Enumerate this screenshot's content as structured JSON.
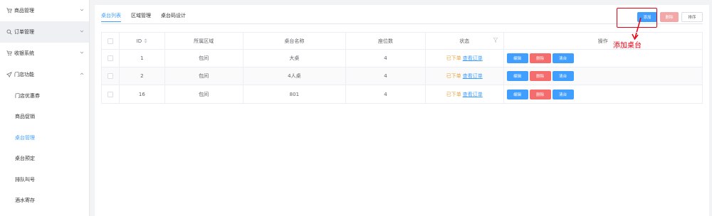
{
  "sidebar": {
    "items": [
      {
        "label": "商品管理",
        "icon": "cart-icon"
      },
      {
        "label": "订单管理",
        "icon": "search-icon"
      },
      {
        "label": "收银系统",
        "icon": "cart-icon"
      },
      {
        "label": "门店功能",
        "icon": "send-icon"
      }
    ],
    "sub_items": [
      "门店优惠券",
      "商品促销",
      "桌台管理",
      "桌台预定",
      "排队叫号",
      "酒水寄存"
    ],
    "active_sub": "桌台管理"
  },
  "tabs": [
    "桌台列表",
    "区域管理",
    "桌台码设计"
  ],
  "toolbar": {
    "add_label": "添加",
    "delete_label": "删除",
    "sort_label": "排序"
  },
  "annotation": {
    "text": "添加桌台"
  },
  "table": {
    "headers": {
      "id": "ID",
      "area": "所属区域",
      "name": "桌台名称",
      "seats": "座位数",
      "status": "状态",
      "ops": "操作"
    },
    "rows": [
      {
        "id": "1",
        "area": "包间",
        "name": "大桌",
        "seats": "4",
        "status": "已下单",
        "status_link": "查看订单"
      },
      {
        "id": "2",
        "area": "包间",
        "name": "4人桌",
        "seats": "4",
        "status": "已下单",
        "status_link": "查看订单"
      },
      {
        "id": "16",
        "area": "包间",
        "name": "801",
        "seats": "4",
        "status": "已下单",
        "status_link": "查看订单"
      }
    ],
    "ops": {
      "edit": "编辑",
      "delete": "删除",
      "clear": "清台"
    }
  },
  "colors": {
    "primary": "#409eff",
    "danger": "#f56c6c",
    "warning": "#e6a23c",
    "annotation": "#e60012"
  }
}
